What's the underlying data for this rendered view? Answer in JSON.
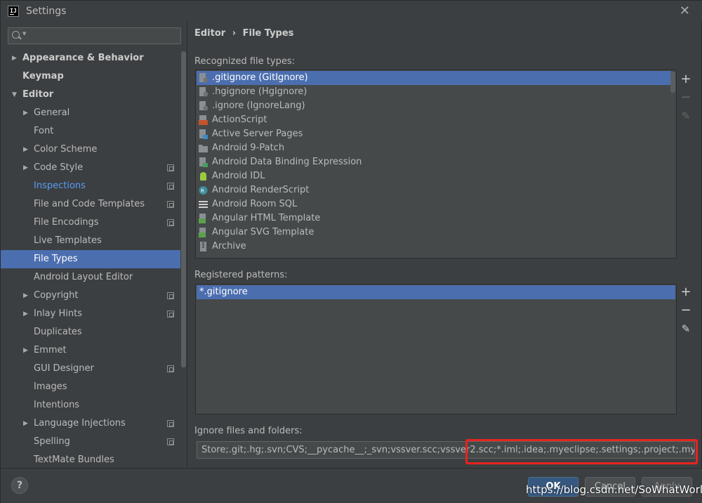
{
  "window": {
    "title": "Settings",
    "app_icon_text": "IJ"
  },
  "search": {
    "value": "",
    "placeholder": ""
  },
  "tree": [
    {
      "label": "Appearance & Behavior",
      "level": 0,
      "arrow": "right",
      "bold": true
    },
    {
      "label": "Keymap",
      "level": 0,
      "arrow": "none",
      "bold": true
    },
    {
      "label": "Editor",
      "level": 0,
      "arrow": "down",
      "bold": true
    },
    {
      "label": "General",
      "level": 1,
      "arrow": "right"
    },
    {
      "label": "Font",
      "level": 1,
      "arrow": "none"
    },
    {
      "label": "Color Scheme",
      "level": 1,
      "arrow": "right"
    },
    {
      "label": "Code Style",
      "level": 1,
      "arrow": "right",
      "copy": true
    },
    {
      "label": "Inspections",
      "level": 1,
      "arrow": "none",
      "copy": true,
      "link": true
    },
    {
      "label": "File and Code Templates",
      "level": 1,
      "arrow": "none",
      "copy": true
    },
    {
      "label": "File Encodings",
      "level": 1,
      "arrow": "none",
      "copy": true
    },
    {
      "label": "Live Templates",
      "level": 1,
      "arrow": "none"
    },
    {
      "label": "File Types",
      "level": 1,
      "arrow": "none",
      "selected": true
    },
    {
      "label": "Android Layout Editor",
      "level": 1,
      "arrow": "none"
    },
    {
      "label": "Copyright",
      "level": 1,
      "arrow": "right",
      "copy": true
    },
    {
      "label": "Inlay Hints",
      "level": 1,
      "arrow": "right",
      "copy": true
    },
    {
      "label": "Duplicates",
      "level": 1,
      "arrow": "none"
    },
    {
      "label": "Emmet",
      "level": 1,
      "arrow": "right"
    },
    {
      "label": "GUI Designer",
      "level": 1,
      "arrow": "none",
      "copy": true
    },
    {
      "label": "Images",
      "level": 1,
      "arrow": "none"
    },
    {
      "label": "Intentions",
      "level": 1,
      "arrow": "none"
    },
    {
      "label": "Language Injections",
      "level": 1,
      "arrow": "right",
      "copy": true
    },
    {
      "label": "Spelling",
      "level": 1,
      "arrow": "none",
      "copy": true
    },
    {
      "label": "TextMate Bundles",
      "level": 1,
      "arrow": "none"
    }
  ],
  "breadcrumb": {
    "parent": "Editor",
    "separator": "›",
    "current": "File Types"
  },
  "recognized": {
    "label": "Recognized file types:",
    "items": [
      {
        "label": ".gitignore (GitIgnore)",
        "icon": "git-file-icon",
        "selected": true
      },
      {
        "label": ".hgignore (HgIgnore)",
        "icon": "hg-file-icon"
      },
      {
        "label": ".ignore (IgnoreLang)",
        "icon": "ignore-file-icon"
      },
      {
        "label": "ActionScript",
        "icon": "actionscript-icon"
      },
      {
        "label": "Active Server Pages",
        "icon": "asp-file-icon"
      },
      {
        "label": "Android 9-Patch",
        "icon": "folder-icon"
      },
      {
        "label": "Android Data Binding Expression",
        "icon": "data-binding-icon"
      },
      {
        "label": "Android IDL",
        "icon": "android-icon"
      },
      {
        "label": "Android RenderScript",
        "icon": "renderscript-icon"
      },
      {
        "label": "Android Room SQL",
        "icon": "room-sql-icon"
      },
      {
        "label": "Angular HTML Template",
        "icon": "angular-html-icon"
      },
      {
        "label": "Angular SVG Template",
        "icon": "angular-svg-icon"
      },
      {
        "label": "Archive",
        "icon": "archive-icon"
      }
    ]
  },
  "patterns": {
    "label": "Registered patterns:",
    "items": [
      {
        "label": "*.gitignore",
        "selected": true
      }
    ]
  },
  "tools": {
    "add": "+",
    "remove": "−",
    "edit": "✎"
  },
  "ignore": {
    "label": "Ignore files and folders:",
    "value": "Store;.git;.hg;.svn;CVS;__pycache__;_svn;vssver.scc;vssver2.scc;*.iml;.idea;.myeclipse;.settings;.project;.mymetadata;"
  },
  "buttons": {
    "help": "?",
    "ok": "OK",
    "cancel": "Cancel",
    "apply": "Apply"
  },
  "watermark": "https://blog.csdn.net/SoWhatWorld",
  "colors": {
    "selection": "#4b6eaf",
    "highlight_box": "#e8231f",
    "link": "#589df6"
  }
}
